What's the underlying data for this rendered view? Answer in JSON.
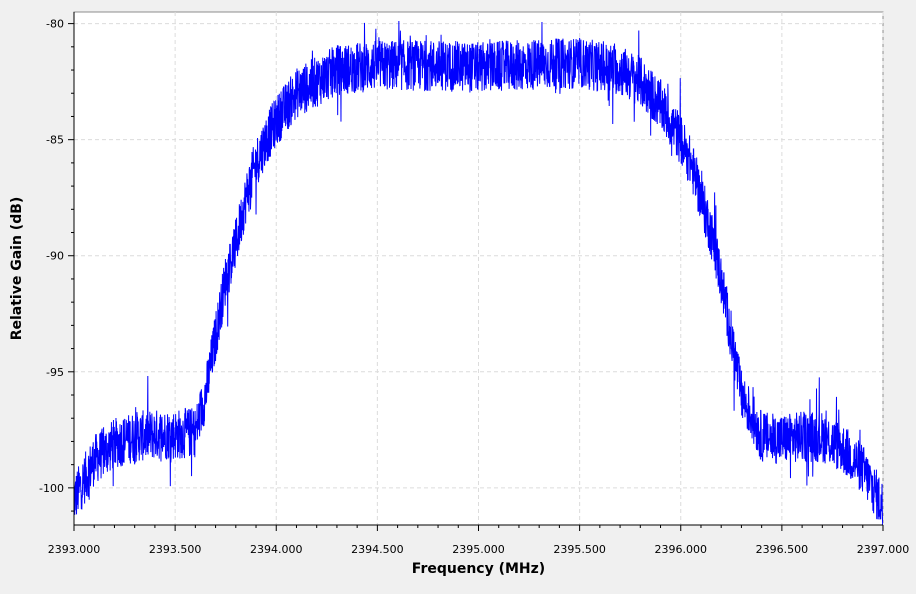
{
  "chart_data": {
    "type": "line",
    "title": "",
    "xlabel": "Frequency (MHz)",
    "ylabel": "Relative Gain (dB)",
    "xlim": [
      2393.0,
      2397.0
    ],
    "ylim": [
      -101.6,
      -79.5
    ],
    "x_ticks": [
      2393.0,
      2393.5,
      2394.0,
      2394.5,
      2395.0,
      2395.5,
      2396.0,
      2396.5,
      2397.0
    ],
    "x_tick_labels": [
      "2393.000",
      "2393.500",
      "2394.000",
      "2394.500",
      "2395.000",
      "2395.500",
      "2396.000",
      "2396.500",
      "2397.000"
    ],
    "y_ticks": [
      -100,
      -95,
      -90,
      -85,
      -80
    ],
    "y_tick_labels": [
      "-100",
      "-95",
      "-90",
      "-85",
      "-80"
    ],
    "grid": true,
    "legend": "none",
    "series": [
      {
        "color": "#0000ff",
        "x": [
          2393.0,
          2393.1,
          2393.2,
          2393.3,
          2393.4,
          2393.5,
          2393.6,
          2393.65,
          2393.7,
          2393.75,
          2393.8,
          2393.85,
          2393.9,
          2393.95,
          2394.0,
          2394.1,
          2394.2,
          2394.3,
          2394.5,
          2394.8,
          2395.0,
          2395.2,
          2395.5,
          2395.7,
          2395.8,
          2395.9,
          2396.0,
          2396.05,
          2396.1,
          2396.15,
          2396.2,
          2396.25,
          2396.3,
          2396.4,
          2396.5,
          2396.6,
          2396.7,
          2396.8,
          2396.9,
          2397.0
        ],
        "values": [
          -100.5,
          -98.8,
          -98.1,
          -97.8,
          -97.7,
          -97.7,
          -97.6,
          -96.0,
          -93.5,
          -91.0,
          -89.5,
          -87.5,
          -86.0,
          -85.0,
          -84.2,
          -83.0,
          -82.5,
          -82.0,
          -81.8,
          -81.8,
          -81.9,
          -81.8,
          -81.7,
          -82.0,
          -82.5,
          -83.5,
          -85.0,
          -86.0,
          -87.5,
          -89.0,
          -91.0,
          -93.5,
          -96.0,
          -97.8,
          -97.9,
          -97.8,
          -97.8,
          -98.3,
          -99.2,
          -100.8
        ],
        "noise_db": 1.1
      }
    ]
  }
}
